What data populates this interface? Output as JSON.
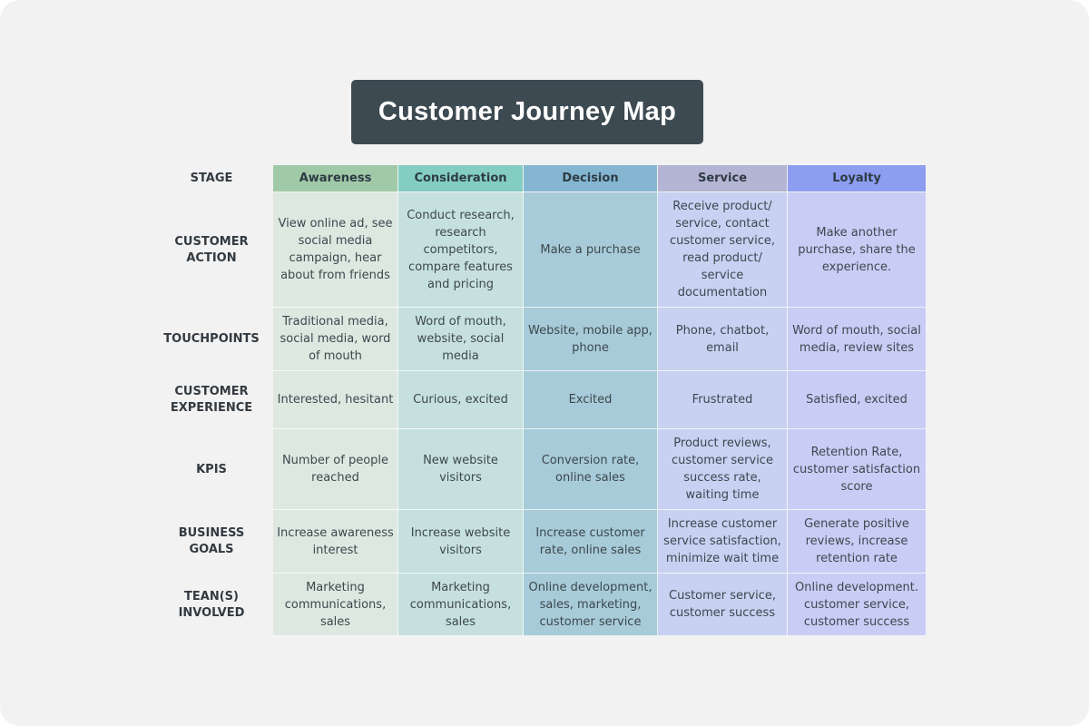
{
  "title": "Customer Journey Map",
  "stage_label": "STAGE",
  "stages": [
    {
      "name": "Awareness",
      "header_color": "#9fc9a7",
      "cell_color": "#dde8e1"
    },
    {
      "name": "Consideration",
      "header_color": "#83cdc2",
      "cell_color": "#c6e1dd"
    },
    {
      "name": "Decision",
      "header_color": "#84b6d2",
      "cell_color": "#a7cbd8"
    },
    {
      "name": "Service",
      "header_color": "#b4b5d4",
      "cell_color": "#c8d1f2"
    },
    {
      "name": "Loyalty",
      "header_color": "#8d9df0",
      "cell_color": "#c9cdf5"
    }
  ],
  "rows": [
    {
      "label": "CUSTOMER ACTION",
      "cells": [
        "View online ad, see social media campaign, hear about from friends",
        "Conduct research, research competitors, compare features and pricing",
        "Make a purchase",
        "Receive product/ service, contact customer service, read product/ service documentation",
        "Make another purchase, share the experience."
      ]
    },
    {
      "label": "TOUCHPOINTS",
      "cells": [
        "Traditional media, social media, word of mouth",
        "Word of mouth, website, social media",
        "Website, mobile app, phone",
        "Phone, chatbot, email",
        "Word of mouth, social media, review sites"
      ]
    },
    {
      "label": "CUSTOMER EXPERIENCE",
      "cells": [
        "Interested, hesitant",
        "Curious, excited",
        "Excited",
        "Frustrated",
        "Satisfied, excited"
      ]
    },
    {
      "label": "KPIS",
      "cells": [
        "Number of people reached",
        "New website visitors",
        "Conversion rate, online sales",
        "Product reviews, customer service success rate, waiting time",
        "Retention Rate, customer satisfaction score"
      ]
    },
    {
      "label": "BUSINESS GOALS",
      "cells": [
        "Increase awareness interest",
        "Increase website visitors",
        "Increase customer rate, online sales",
        "Increase customer service satisfaction, minimize wait time",
        "Generate positive reviews, increase retention rate"
      ]
    },
    {
      "label": "TEAN(S) INVOLVED",
      "cells": [
        "Marketing communications, sales",
        "Marketing communications, sales",
        "Online development, sales, marketing, customer service",
        "Customer service, customer success",
        "Online development. customer service, customer success"
      ]
    }
  ]
}
